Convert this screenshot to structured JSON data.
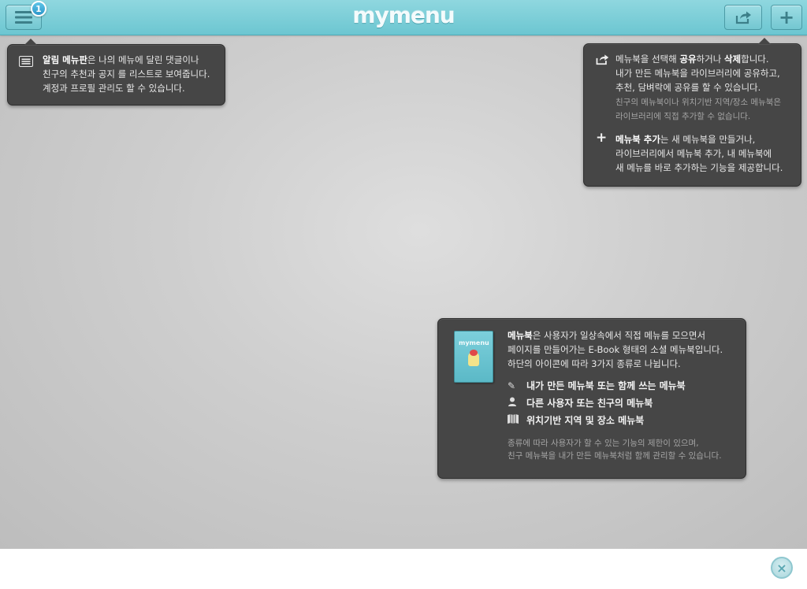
{
  "header": {
    "logo": "mymenu",
    "badge_count": "1",
    "menu_icon": "hamburger-icon",
    "share_icon": "share-icon",
    "add_label": "+"
  },
  "tip_notifications": {
    "title": "알림 메뉴판",
    "line1_rest": "은 나의 메뉴에 달린 댓글이나",
    "line2": "친구의 추천과 공지 를 리스트로 보여줍니다.",
    "line3": "계정과 프로필 관리도 할 수 있습니다."
  },
  "tip_share": {
    "line1_pre": "메뉴북을 선택해 ",
    "line1_b1": "공유",
    "line1_mid": "하거나 ",
    "line1_b2": "삭제",
    "line1_end": "합니다.",
    "line2": "내가 만든 메뉴북을 라이브러리에 공유하고,",
    "line3": "추천, 담벼락에 공유를 할 수 있습니다.",
    "note1": "친구의 메뉴북이나 위치기반 지역/장소 메뉴북은",
    "note2": "라이브러리에 직접 추가할 수 없습니다.",
    "add_b": "메뉴북 추가",
    "add_rest": "는 새 메뉴북을 만들거나,",
    "add_line2": "라이브러리에서 메뉴북 추가, 내 메뉴북에",
    "add_line3": "새 메뉴를 바로 추가하는 기능을 제공합니다."
  },
  "tip_menubook": {
    "cover_title": "mymenu",
    "title": "메뉴북",
    "line1_rest": "은 사용자가 일상속에서 직접 메뉴를 모으면서",
    "line2": "페이지를 만들어가는 E-Book 형태의 소셜 메뉴북입니다.",
    "line3": "하단의 아이콘에 따라 3가지 종류로 나뉩니다.",
    "types": [
      {
        "icon": "pencil-icon",
        "label": "내가 만든 메뉴북 또는 함께 쓰는 메뉴북"
      },
      {
        "icon": "person-icon",
        "label": "다른 사용자 또는 친구의 메뉴북"
      },
      {
        "icon": "map-icon",
        "label": "위치기반 지역 및 장소 메뉴북"
      }
    ],
    "note1": "종류에 따라 사용자가 할 수 있는 기능의 제한이 있으며,",
    "note2": "친구 메뉴북을 내가 만든 메뉴북처럼 함께 관리할 수 있습니다."
  },
  "close_label": "×"
}
